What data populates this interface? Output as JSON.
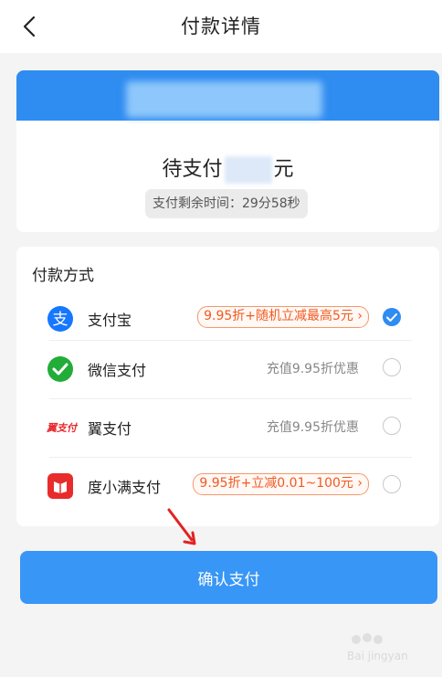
{
  "header": {
    "title": "付款详情"
  },
  "summary": {
    "pending_prefix": "待支付",
    "pending_suffix": "元",
    "timer_text": "支付剩余时间：29分58秒"
  },
  "payment": {
    "section_label": "付款方式",
    "methods": [
      {
        "name": "支付宝",
        "promo": "9.95折+随机立减最高5元",
        "selected": true,
        "icon": "alipay-icon"
      },
      {
        "name": "微信支付",
        "note": "充值9.95折优惠",
        "selected": false,
        "icon": "wechat-pay-icon"
      },
      {
        "name": "翼支付",
        "note": "充值9.95折优惠",
        "selected": false,
        "icon": "bestpay-icon"
      },
      {
        "name": "度小满支付",
        "promo": "9.95折+立减0.01~100元",
        "selected": false,
        "icon": "duxiaoman-icon"
      }
    ]
  },
  "confirm_label": "确认支付",
  "colors": {
    "accent": "#3896f6",
    "promo": "#f15a22",
    "header_banner": "#2f8cf0"
  }
}
